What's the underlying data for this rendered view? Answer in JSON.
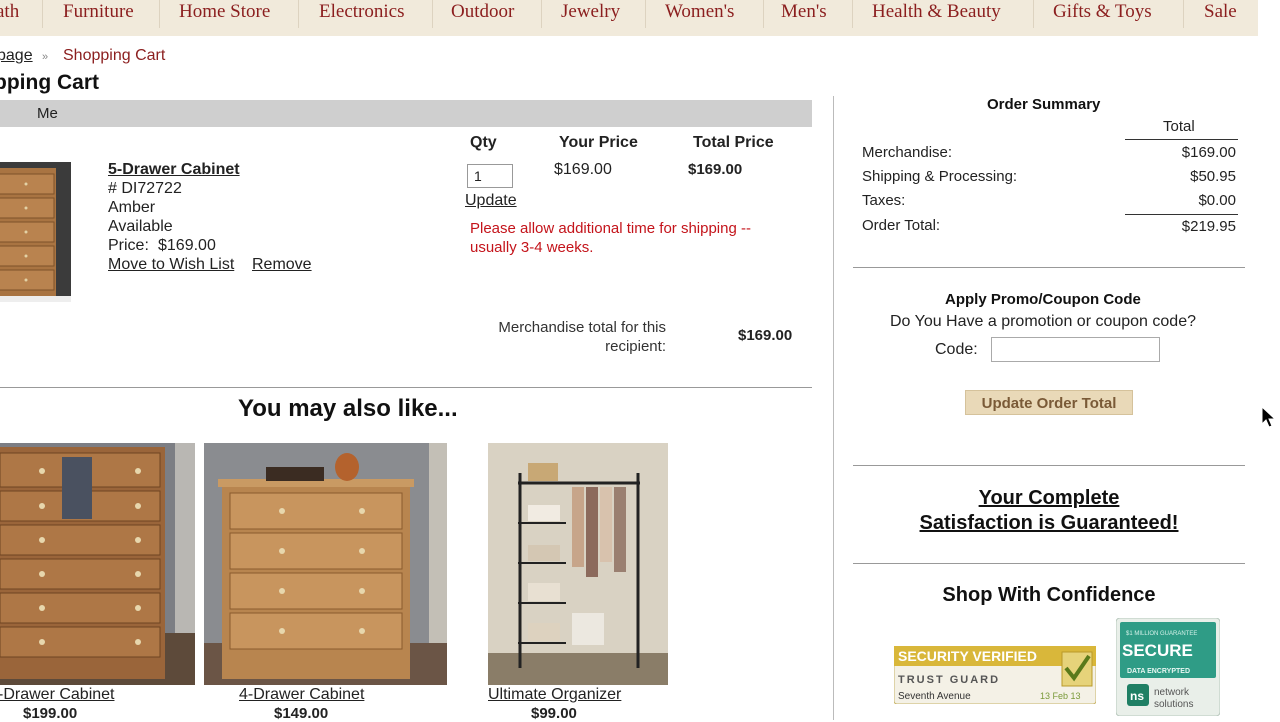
{
  "nav": {
    "items": [
      "ath",
      "Furniture",
      "Home Store",
      "Electronics",
      "Outdoor",
      "Jewelry",
      "Women's",
      "Men's",
      "Health & Beauty",
      "Gifts & Toys",
      "Sale"
    ]
  },
  "breadcrumb": {
    "home": "page",
    "separator": "»",
    "current": "Shopping Cart"
  },
  "page_title": "pping Cart",
  "recipient": {
    "name": "Me"
  },
  "columns": {
    "qty": "Qty",
    "your_price": "Your Price",
    "total_price": "Total Price"
  },
  "cart_item": {
    "name": "5-Drawer Cabinet",
    "sku": "# DI72722",
    "color": "Amber",
    "availability": "Available",
    "price_label": "Price:",
    "price": "$169.00",
    "move_to_wishlist": "Move to Wish List",
    "remove": "Remove",
    "qty": "1",
    "update": "Update",
    "your_price": "$169.00",
    "total_price": "$169.00",
    "shipping_note": "Please allow additional time for shipping -- usually 3-4 weeks."
  },
  "merchandise_total": {
    "label": "Merchandise total for this recipient:",
    "value": "$169.00"
  },
  "recommendations": {
    "title": "You may also like...",
    "items": [
      {
        "name": "-Drawer Cabinet",
        "price": "$199.00"
      },
      {
        "name": "4-Drawer Cabinet",
        "price": "$149.00"
      },
      {
        "name": "Ultimate Organizer",
        "price": "$99.00"
      }
    ]
  },
  "order_summary": {
    "title": "Order Summary",
    "total_head": "Total",
    "rows": [
      {
        "label": "Merchandise:",
        "value": "$169.00"
      },
      {
        "label": "Shipping & Processing:",
        "value": "$50.95"
      },
      {
        "label": "Taxes:",
        "value": "$0.00"
      },
      {
        "label": "Order Total:",
        "value": "$219.95"
      }
    ]
  },
  "promo": {
    "title": "Apply Promo/Coupon Code",
    "question": "Do You Have a promotion or coupon code?",
    "code_label": "Code:",
    "code_value": "",
    "button": "Update Order Total"
  },
  "guarantee": {
    "line1": "Your Complete",
    "line2": "Satisfaction is Guaranteed!"
  },
  "confidence": "Shop With Confidence",
  "badges": {
    "trust": {
      "top": "SECURITY VERIFIED",
      "mid": "TRUST GUARD",
      "site": "Seventh Avenue",
      "date": "13 Feb 13"
    },
    "secure": {
      "top": "$1 MILLION GUARANTEE",
      "main": "SECURE",
      "sub": "DATA ENCRYPTED",
      "brand1": "network",
      "brand2": "solutions"
    }
  },
  "colors": {
    "nav_bg": "#f1eadb",
    "nav_text": "#8b1e1e",
    "alert_red": "#c4141b",
    "button_bg": "#e9d9b8",
    "button_text": "#7a5a37"
  }
}
